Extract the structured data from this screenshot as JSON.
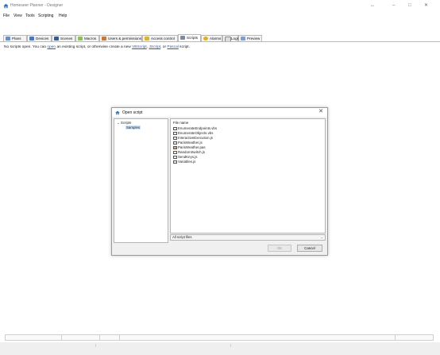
{
  "window": {
    "title": "Homeseer Planner - Designer",
    "controls": [
      "↔",
      "–",
      "□",
      "✕"
    ]
  },
  "menu": [
    "File",
    "View",
    "Tools",
    "Scripting",
    "Help"
  ],
  "tabs": [
    {
      "label": "Plans",
      "icon": "plans-icon",
      "color": "#6a8fc7"
    },
    {
      "label": "Devices",
      "icon": "devices-icon",
      "color": "#4a78c0"
    },
    {
      "label": "Scenes",
      "icon": "scenes-icon",
      "color": "#3b5b8c"
    },
    {
      "label": "Macros",
      "icon": "macros-icon",
      "color": "#8fbf5f"
    },
    {
      "label": "Users & permissions",
      "icon": "users-icon",
      "color": "#c07a40"
    },
    {
      "label": "Access control",
      "icon": "access-control-icon",
      "color": "#d8b23a"
    },
    {
      "label": "Scripts",
      "icon": "scripts-icon",
      "color": "#7a8aa0"
    },
    {
      "label": "Alarms",
      "icon": "alarms-icon",
      "color": "#e0b020"
    },
    {
      "label": "Logs",
      "icon": "logs-icon",
      "color": "#dddddd"
    },
    {
      "label": "Preview",
      "icon": "preview-icon",
      "color": "#7ea0c8"
    }
  ],
  "active_tab": "Scripts",
  "info": {
    "before": "No scripts open. You can",
    "open_link": "open",
    "middle": "an existing script, or otherwise create a new",
    "vbs_link": "VBScript",
    "comma": ",",
    "js_link": "JScript",
    "or": ", or",
    "pascal_link": "Pascal",
    "after": "script."
  },
  "dialog": {
    "title": "Open script",
    "tree": {
      "root": "Scripts",
      "child": "Samples"
    },
    "files_header": "File name",
    "files": [
      "EnumerateEndpoints.vbs",
      "EnumerateObjects.vbs",
      "InteractiveExecution.js",
      "ParisWeather.js",
      "ParisWeather.pas",
      "RandomSwitch.js",
      "SendKeys.js",
      "Variables.js"
    ],
    "filter": "All script files",
    "ok_label": "OK",
    "cancel_label": "Cancel"
  },
  "colors": {
    "link": "#2a5db0",
    "accent": "#2a6fb0",
    "selection": "#cfe3f7"
  }
}
